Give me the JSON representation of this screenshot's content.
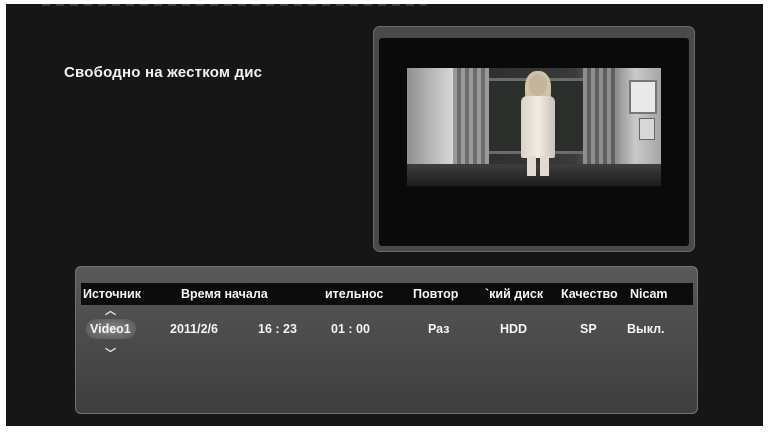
{
  "disk_free_label": "Свободно на жестком дис",
  "table": {
    "headers": {
      "source": "Источник",
      "start_time": "Время начала",
      "duration": "ительнос",
      "repeat": "Повтор",
      "disk": "`кий диск",
      "quality": "Качество",
      "nicam": "Nicam"
    },
    "row": {
      "source": "Video1",
      "date": "2011/2/6",
      "start_time": "16 : 23",
      "duration": "01 : 00",
      "repeat": "Раз",
      "disk": "HDD",
      "quality": "SP",
      "nicam": "Выкл."
    },
    "source_arrow_up": "︿",
    "source_arrow_down": "﹀"
  },
  "icons": {
    "source_up": "chevron-up-icon",
    "source_down": "chevron-down-icon"
  },
  "colors": {
    "background": "#161616",
    "panel": "#505050",
    "header_bar": "#0c0c0c",
    "text": "#f5f5f5"
  }
}
